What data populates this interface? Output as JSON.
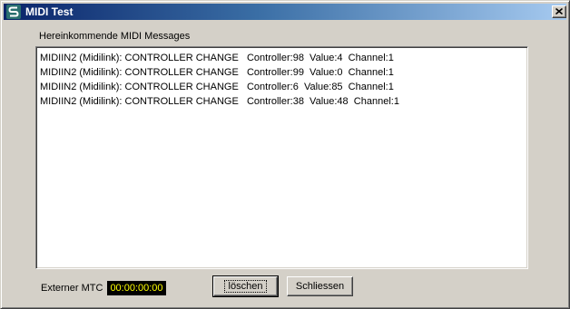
{
  "window": {
    "title": "MIDI Test",
    "icon": "app-logo-icon",
    "close_icon": "close-icon"
  },
  "messages": {
    "label": "Hereinkommende MIDI Messages",
    "items": [
      "MIDIIN2 (Midilink): CONTROLLER CHANGE   Controller:98  Value:4  Channel:1",
      "MIDIIN2 (Midilink): CONTROLLER CHANGE   Controller:99  Value:0  Channel:1",
      "MIDIIN2 (Midilink): CONTROLLER CHANGE   Controller:6  Value:85  Channel:1",
      "MIDIIN2 (Midilink): CONTROLLER CHANGE   Controller:38  Value:48  Channel:1"
    ]
  },
  "mtc": {
    "label": "Externer MTC",
    "value": "00:00:00:00",
    "display_bg": "#000000",
    "display_fg": "#ffff00"
  },
  "buttons": {
    "clear_label": "löschen",
    "close_label": "Schliessen"
  },
  "colors": {
    "titlebar_start": "#0a246a",
    "titlebar_end": "#a6caf0",
    "face": "#d4d0c8"
  }
}
